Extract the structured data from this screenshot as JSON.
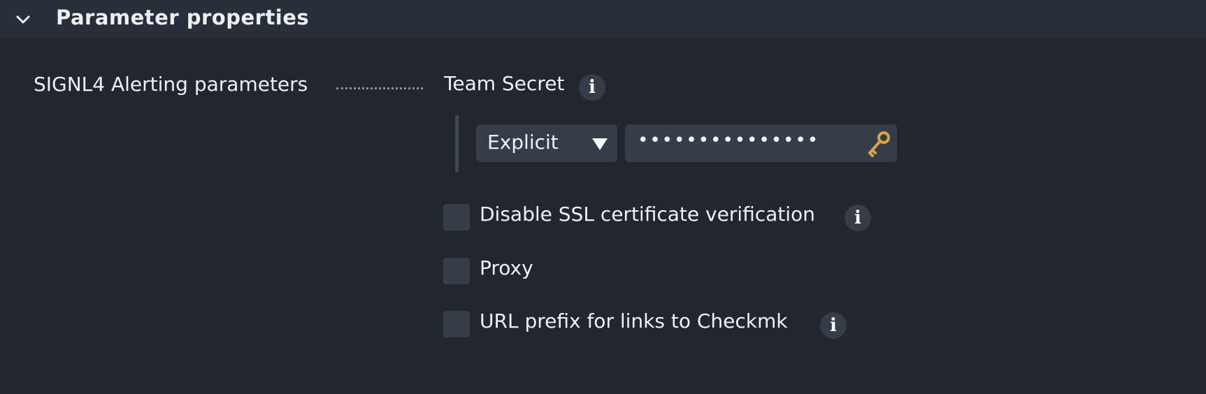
{
  "header": {
    "title": "Parameter properties",
    "collapse_icon": "chevron-down-icon"
  },
  "params": {
    "label": "SIGNL4 Alerting parameters",
    "team_secret": {
      "label": "Team Secret",
      "info_icon": "info-icon",
      "mode_selected": "Explicit",
      "password_masked": "•••••••••••••••",
      "key_icon": "key-icon"
    },
    "options": [
      {
        "label": "Disable SSL certificate verification",
        "checked": false,
        "has_info": true
      },
      {
        "label": "Proxy",
        "checked": false,
        "has_info": false
      },
      {
        "label": "URL prefix for links to Checkmk",
        "checked": false,
        "has_info": true
      }
    ]
  },
  "colors": {
    "background": "#21262f",
    "header": "#282f3a",
    "control": "#353d49",
    "text": "#eef1f4",
    "key_gold": "#d9a441"
  }
}
